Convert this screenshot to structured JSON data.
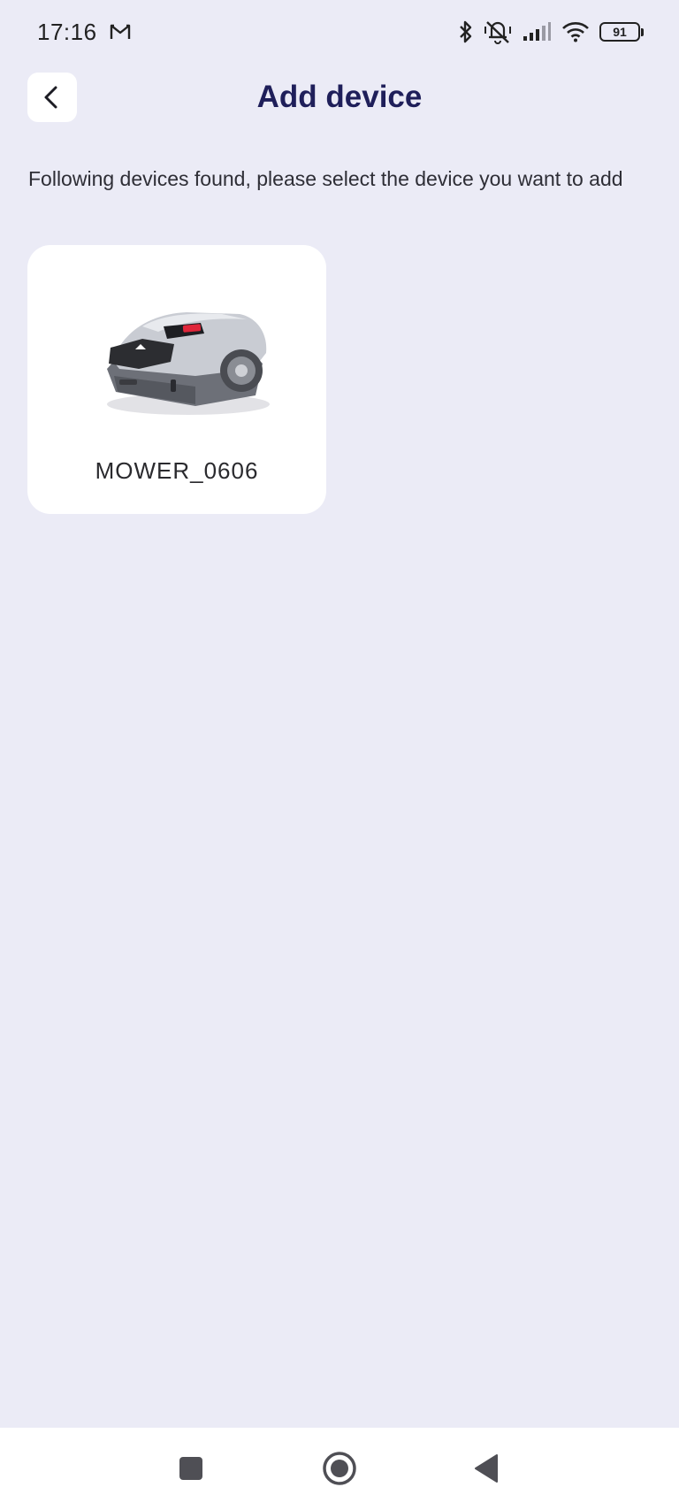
{
  "status_bar": {
    "time": "17:16",
    "battery_level": "91",
    "icons": [
      "gmail-icon",
      "bluetooth-icon",
      "vibrate-off-icon",
      "signal-icon",
      "wifi-icon",
      "battery-icon"
    ]
  },
  "header": {
    "title": "Add device",
    "back_icon": "chevron-left-icon"
  },
  "instructions": "Following devices found, please select the device you want to add",
  "devices": [
    {
      "name": "MOWER_0606",
      "image": "robot-mower"
    }
  ],
  "nav_bar": {
    "buttons": [
      "recents",
      "home",
      "back"
    ]
  },
  "colors": {
    "background": "#ebebf6",
    "card": "#ffffff",
    "title": "#1f1f5a",
    "mower_accent": "#e0263a"
  }
}
